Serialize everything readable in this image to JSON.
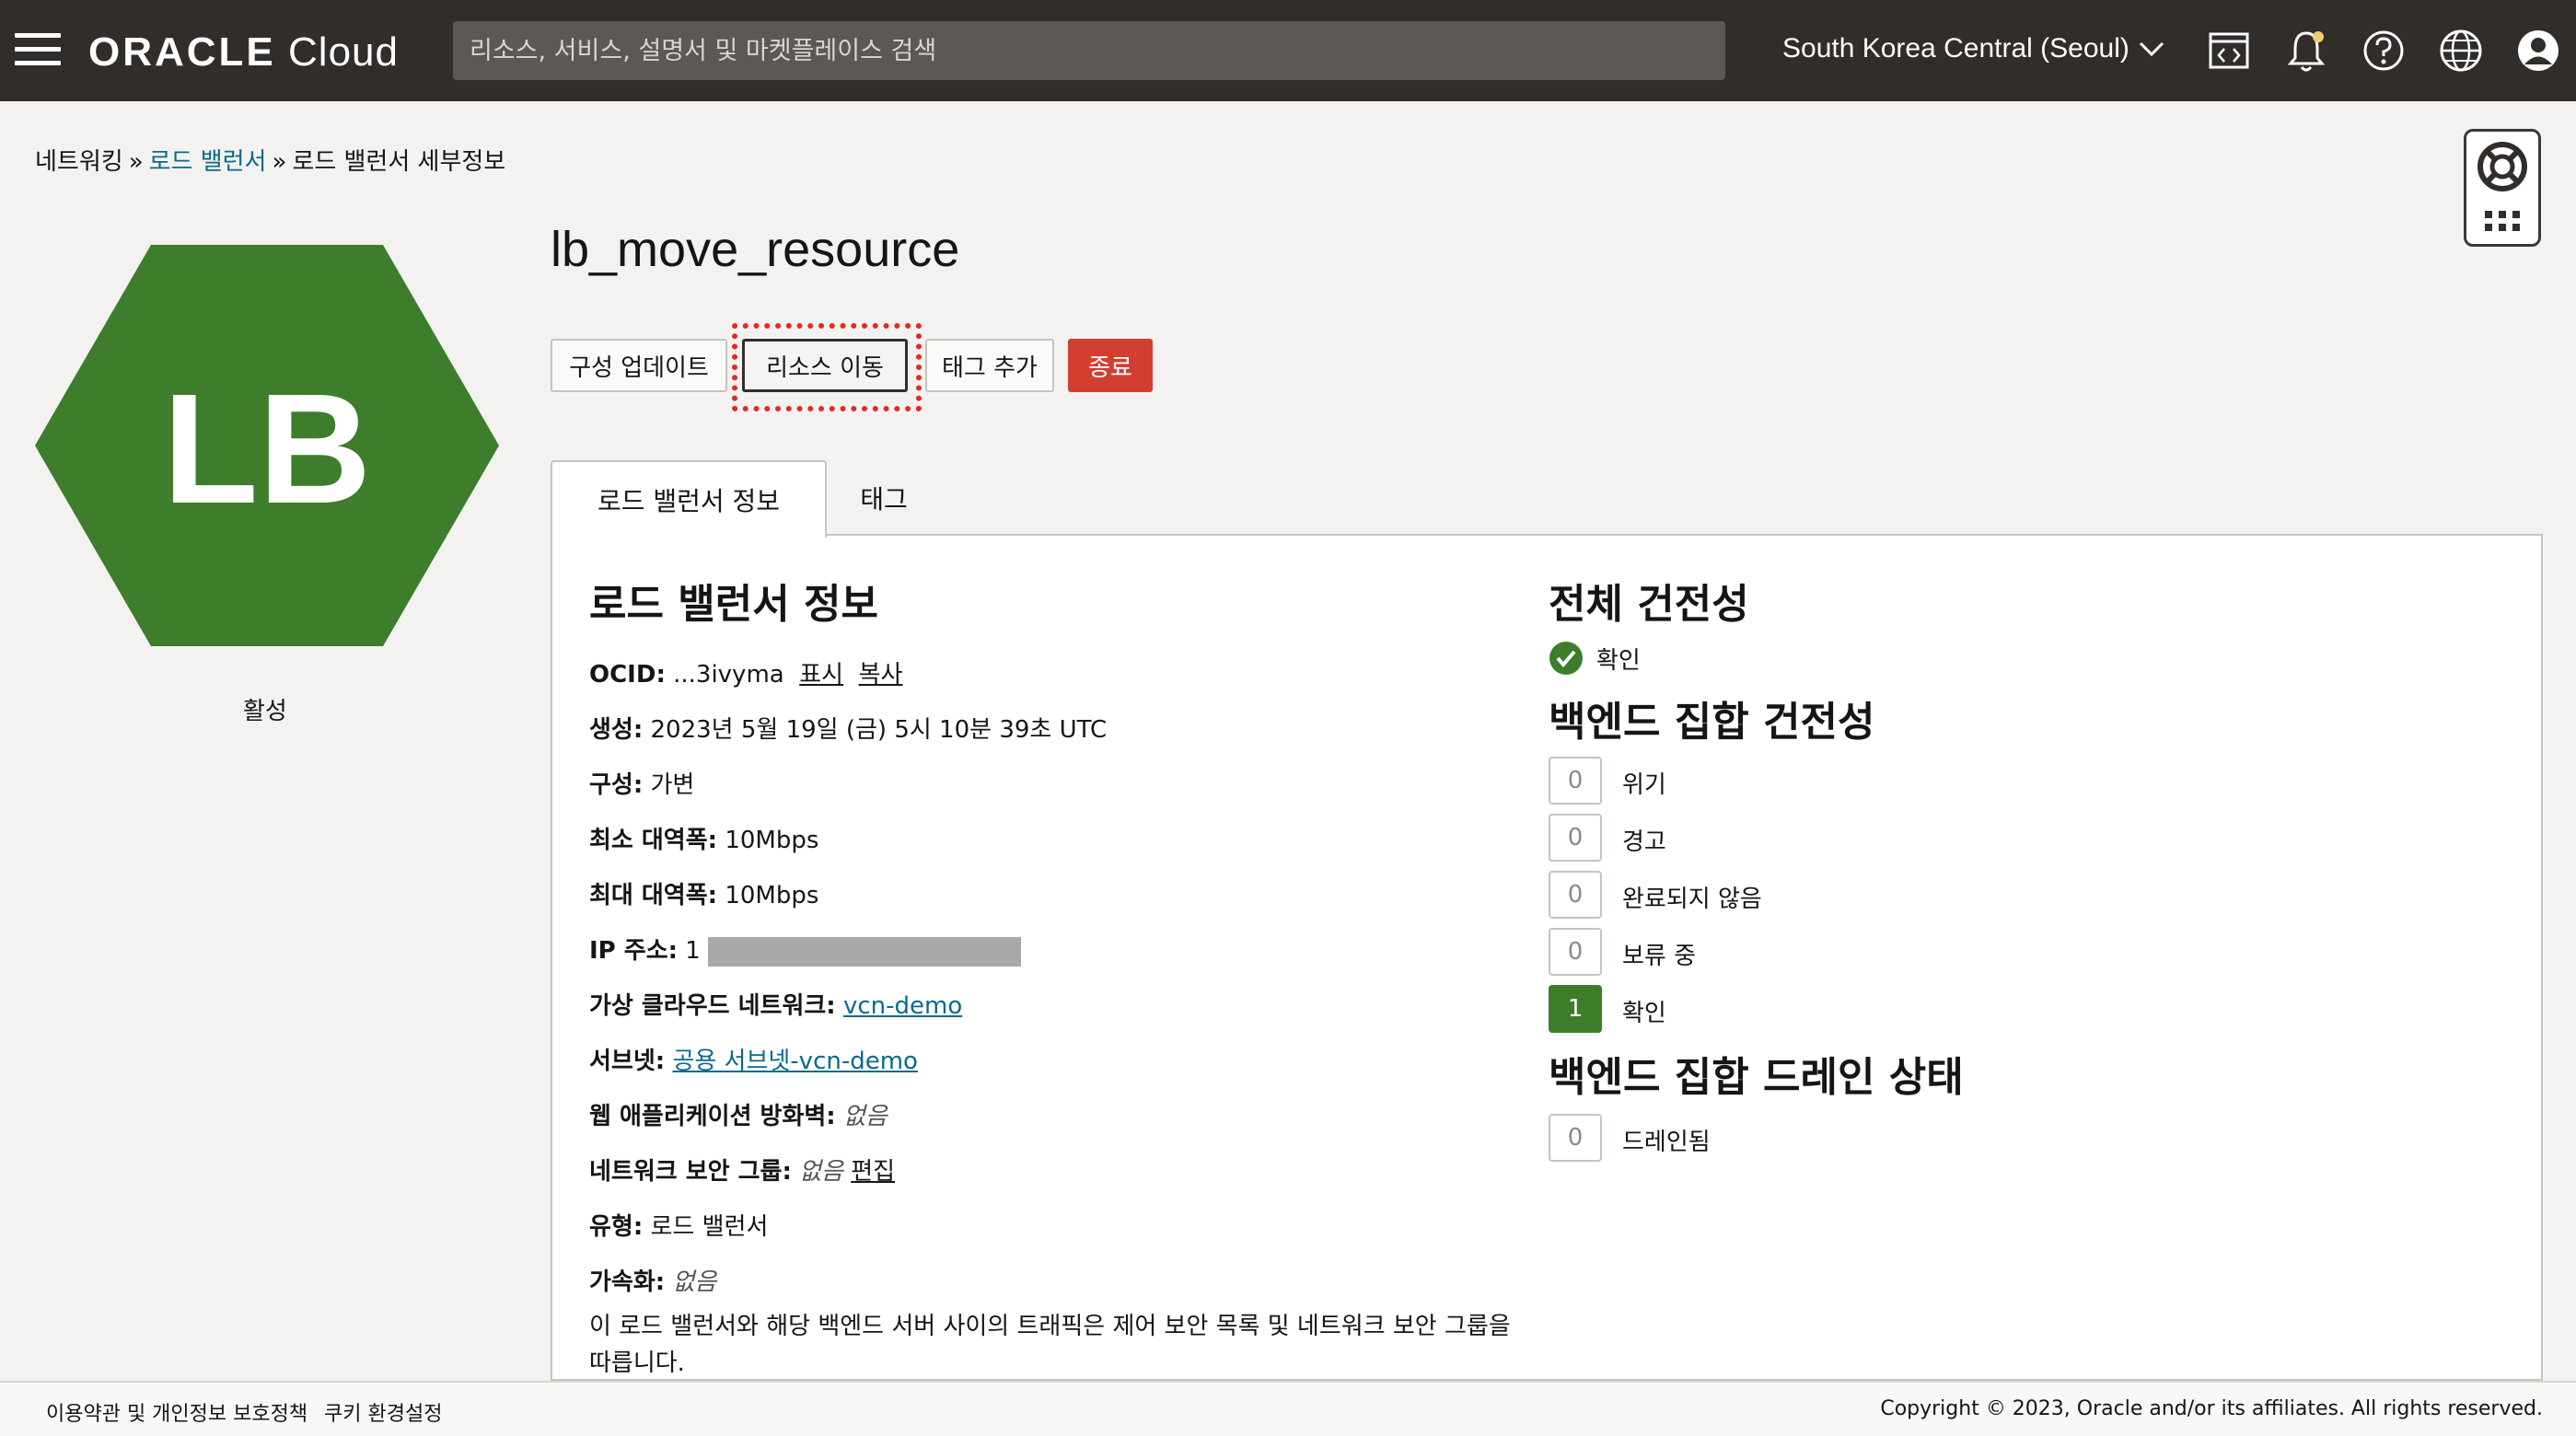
{
  "header": {
    "logo_bold": "ORACLE",
    "logo_light": "Cloud",
    "search_placeholder": "리소스, 서비스, 설명서 및 마켓플레이스 검색",
    "region": "South Korea Central (Seoul)"
  },
  "breadcrumb": {
    "root": "네트워킹",
    "parent": "로드 밸런서",
    "current": "로드 밸런서 세부정보",
    "separator": "»"
  },
  "resource": {
    "icon_text": "LB",
    "status": "활성",
    "name": "lb_move_resource",
    "icon_color": "#3d7d2c"
  },
  "actions": {
    "update": "구성 업데이트",
    "move": "리소스 이동",
    "add_tags": "태그 추가",
    "terminate": "종료"
  },
  "tabs": {
    "info": "로드 밸런서 정보",
    "tags": "태그"
  },
  "info": {
    "title": "로드 밸런서 정보",
    "ocid_label": "OCID:",
    "ocid_value": "...3ivyma",
    "ocid_show": "표시",
    "ocid_copy": "복사",
    "created_label": "생성:",
    "created_value": "2023년 5월 19일 (금) 5시 10분 39초 UTC",
    "shape_label": "구성:",
    "shape_value": "가변",
    "min_bw_label": "최소 대역폭:",
    "min_bw_value": "10Mbps",
    "max_bw_label": "최대 대역폭:",
    "max_bw_value": "10Mbps",
    "ip_label": "IP 주소:",
    "ip_prefix": "1",
    "vcn_label": "가상 클라우드 네트워크:",
    "vcn_value": "vcn-demo",
    "subnet_label": "서브넷:",
    "subnet_value": "공용 서브넷-vcn-demo",
    "waf_label": "웹 애플리케이션 방화벽:",
    "waf_value": "없음",
    "nsg_label": "네트워크 보안 그룹:",
    "nsg_value": "없음",
    "nsg_edit": "편집",
    "type_label": "유형:",
    "type_value": "로드 밸런서",
    "accel_label": "가속화:",
    "accel_value": "없음",
    "note_line1": "이 로드 밸런서와 해당 백엔드 서버 사이의 트래픽은 제어 보안 목록 및 네트워크 보안 그룹을",
    "note_line2": "따릅니다."
  },
  "health": {
    "overall_title": "전체 건전성",
    "overall_value": "확인",
    "backend_title": "백엔드 집합 건전성",
    "backend": [
      {
        "count": "0",
        "label": "위기"
      },
      {
        "count": "0",
        "label": "경고"
      },
      {
        "count": "0",
        "label": "완료되지 않음"
      },
      {
        "count": "0",
        "label": "보류 중"
      },
      {
        "count": "1",
        "label": "확인"
      }
    ],
    "drain_title": "백엔드 집합 드레인 상태",
    "drain": [
      {
        "count": "0",
        "label": "드레인됨"
      }
    ]
  },
  "footer": {
    "terms": "이용약관 및 개인정보 보호정책",
    "cookies": "쿠키 환경설정",
    "copyright": "Copyright © 2023, Oracle and/or its affiliates. All rights reserved."
  }
}
